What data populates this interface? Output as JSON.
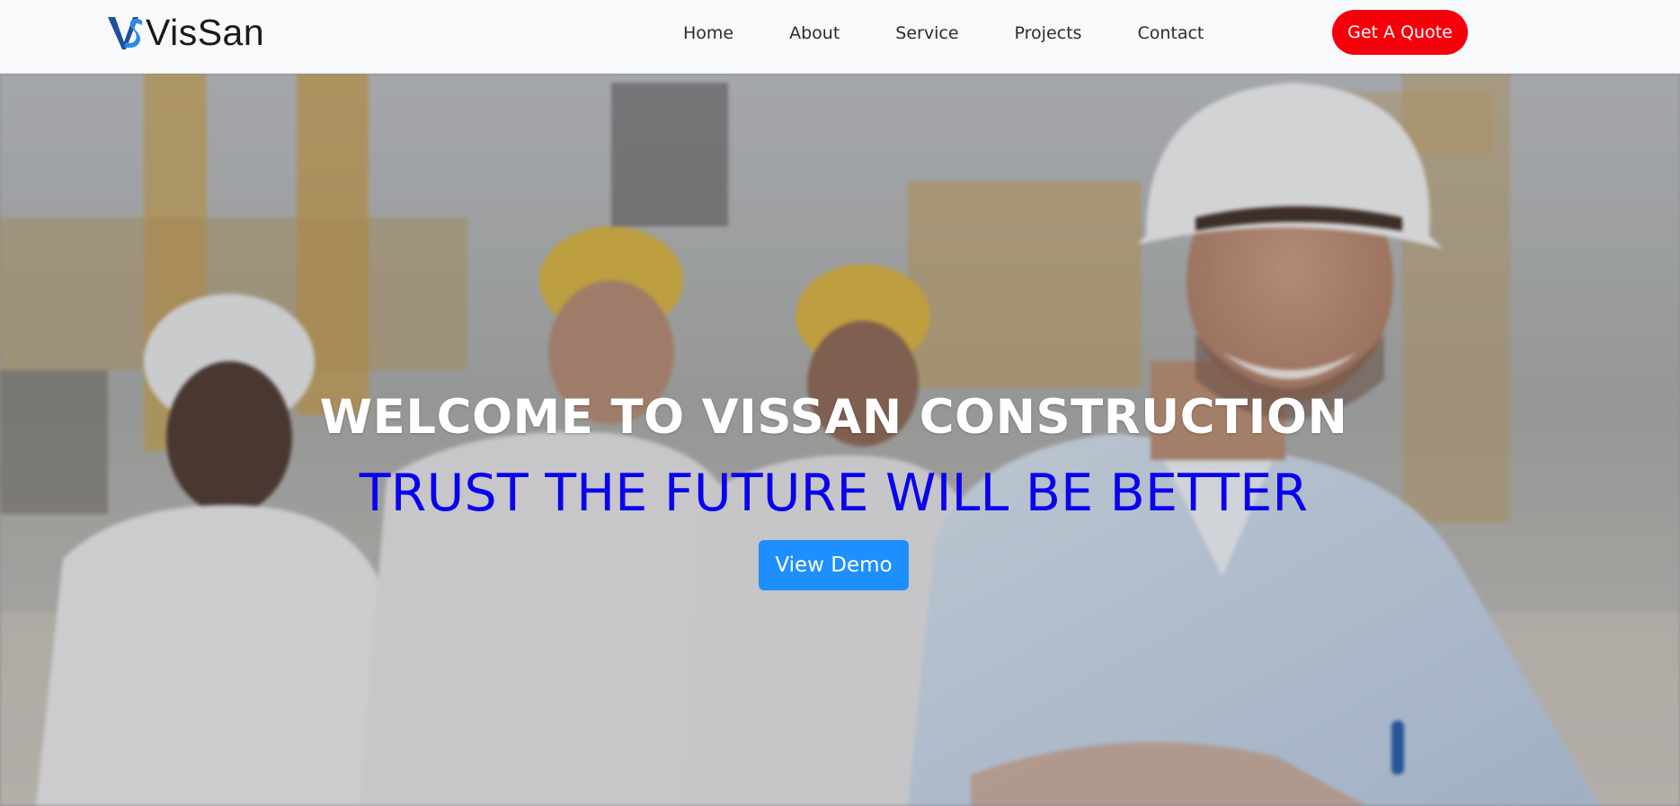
{
  "brand": {
    "mark_text": "VS",
    "name": "VisSan"
  },
  "nav": {
    "links": [
      "Home",
      "About",
      "Service",
      "Projects",
      "Contact"
    ],
    "cta": "Get A Quote"
  },
  "hero": {
    "title": "WELCOME TO VISSAN CONSTRUCTION",
    "subtitle": "TRUST THE FUTURE WILL BE BETTER",
    "button": "View Demo",
    "image": "construction-workers-hard-hats-photo"
  },
  "colors": {
    "cta_red": "#f5010b",
    "subtitle_blue": "#0a00f0",
    "demo_blue": "#1e8fff",
    "logo_blue": "#1570c9"
  }
}
